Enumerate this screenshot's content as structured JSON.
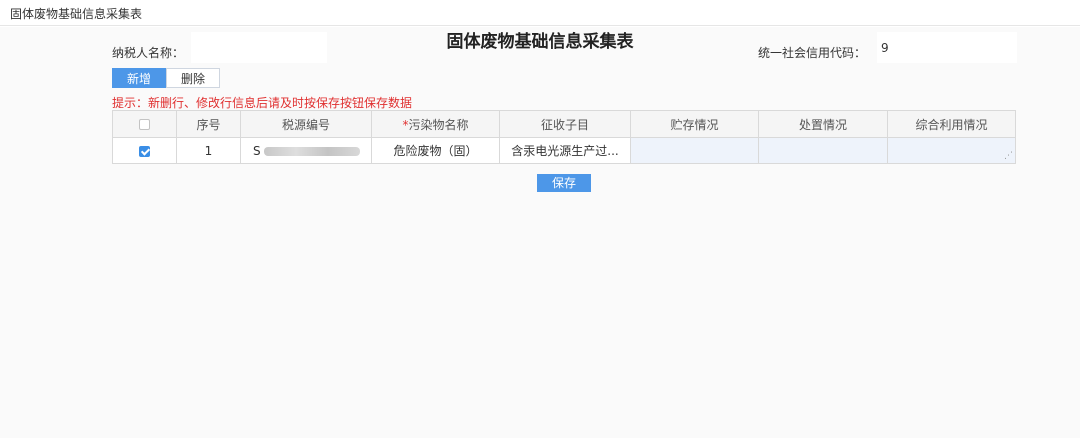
{
  "tab": {
    "title": "固体废物基础信息采集表"
  },
  "form": {
    "title": "固体废物基础信息采集表",
    "taxpayer_label": "纳税人名称：",
    "taxpayer_value": "",
    "credit_code_label": "统一社会信用代码：",
    "credit_code_value": "9"
  },
  "toolbar": {
    "add_label": "新增",
    "delete_label": "删除"
  },
  "hint": "提示：新删行、修改行信息后请及时按保存按钮保存数据",
  "table": {
    "columns": {
      "check": "",
      "index": "序号",
      "source_no": "税源编号",
      "pollutant_req": "*",
      "pollutant": "污染物名称",
      "sub_item": "征收子目",
      "storage": "贮存情况",
      "disposal": "处置情况",
      "utilization": "综合利用情况"
    },
    "rows": [
      {
        "checked": true,
        "index": "1",
        "source_no": "S",
        "pollutant": "危险废物（固）",
        "sub_item": "含汞电光源生产过...",
        "storage": "",
        "disposal": "",
        "utilization": ""
      }
    ]
  },
  "save_label": "保存",
  "colors": {
    "primary": "#4d97e8",
    "warning": "#e03030",
    "editable_bg": "#eef3fb"
  }
}
